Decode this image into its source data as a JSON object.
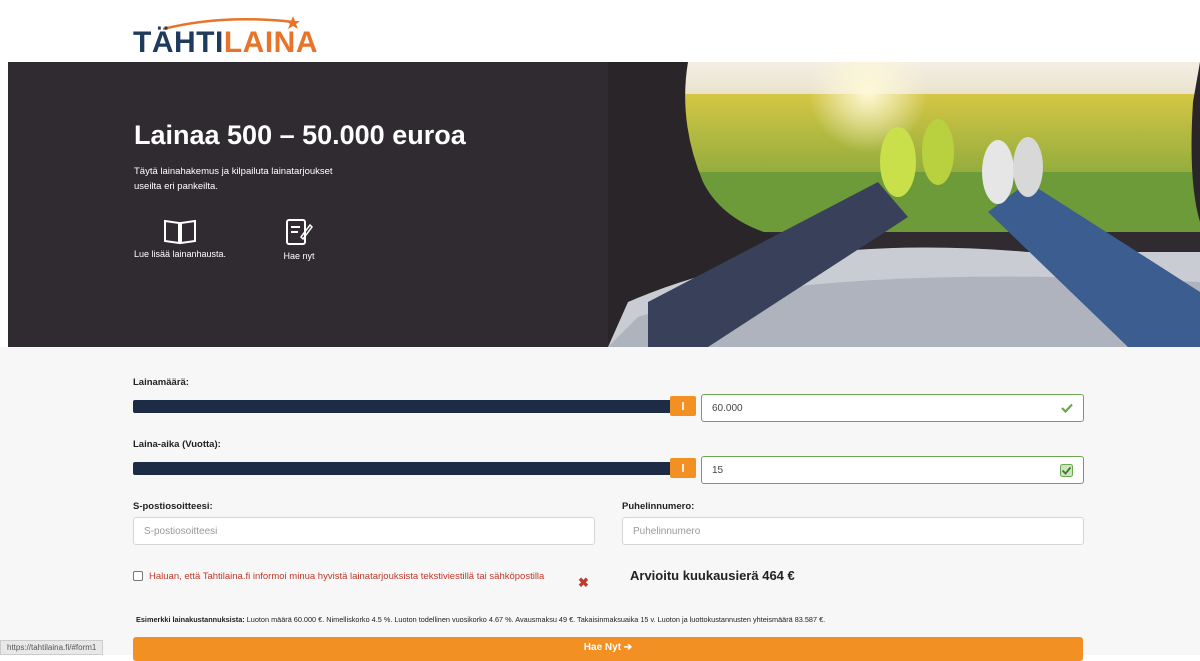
{
  "brand": {
    "logo_part1": "TÄHTI",
    "logo_part2": "LAINA",
    "primary": "#1e3a5c",
    "accent": "#e8742a"
  },
  "hero": {
    "title": "Lainaa 500 – 50.000 euroa",
    "subtitle": "Täytä lainahakemus ja kilpailuta lainatarjoukset useilta eri pankeilta.",
    "actions": [
      {
        "label": "Lue lisää lainanhausta.",
        "icon": "book-icon"
      },
      {
        "label": "Hae nyt",
        "icon": "edit-form-icon"
      }
    ]
  },
  "form": {
    "amount": {
      "label": "Lainamäärä:",
      "value": "60.000",
      "slider_fraction": 1.0
    },
    "term": {
      "label": "Laina-aika (Vuotta):",
      "value": "15",
      "slider_fraction": 1.0
    },
    "email": {
      "label": "S-postiosoitteesi:",
      "placeholder": "S-postiosoitteesi"
    },
    "phone": {
      "label": "Puhelinnumero:",
      "placeholder": "Puhelinnumero"
    },
    "consent": {
      "text": "Haluan, että Tahtilaina.fi informoi minua hyvistä lainatarjouksista tekstiviestillä tai sähköpostilla",
      "checked": false
    },
    "estimate": "Arvioitu kuukausierä 464 €",
    "example_label": "Esimerkki lainakustannuksista:",
    "example_text": " Luoton määrä 60.000 €. Nimelliskorko 4.5 %. Luoton todellinen vuosikorko 4.67 %. Avausmaksu 49 €. Takaisinmaksuaika 15 v. Luoton ja luottokustannusten yhteismäärä 83.587 €.",
    "submit": "Hae Nyt ➔"
  },
  "status_bar": {
    "url": "https://tahtilaina.fi/#form1"
  },
  "colors": {
    "slider_track": "#1d2b44",
    "slider_handle": "#f29024",
    "cta": "#f29024",
    "valid": "#6aa84f",
    "error": "#c0392b"
  }
}
